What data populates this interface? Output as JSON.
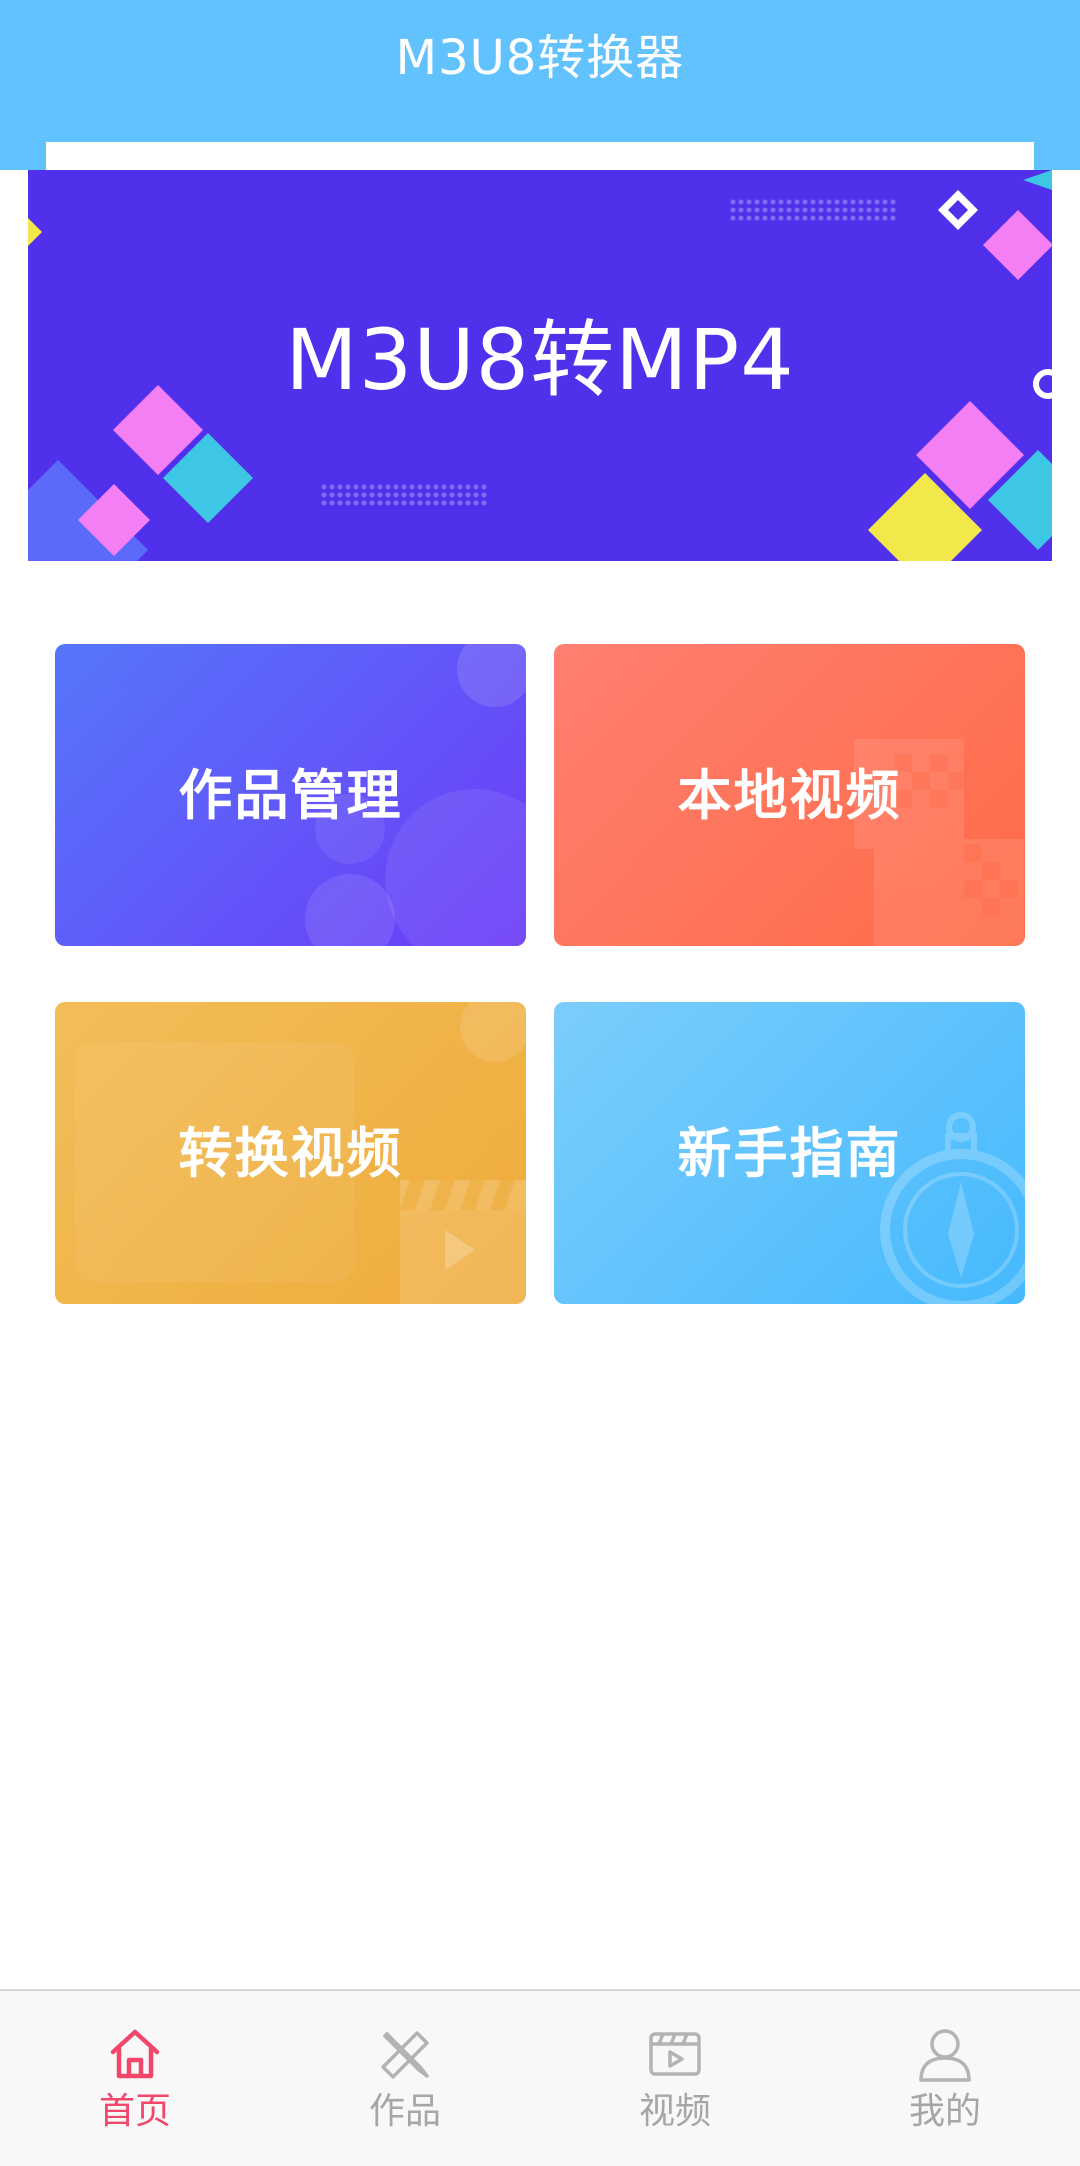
{
  "header": {
    "title": "M3U8转换器",
    "color": "#62c2fd"
  },
  "banner": {
    "text": "M3U8转MP4",
    "background": "#5130ec"
  },
  "cards": [
    {
      "id": "works",
      "label": "作品管理",
      "icon": "bubbles-decoration"
    },
    {
      "id": "local",
      "label": "本地视频",
      "icon": "checker-decoration"
    },
    {
      "id": "convert",
      "label": "转换视频",
      "icon": "clapperboard-icon"
    },
    {
      "id": "guide",
      "label": "新手指南",
      "icon": "compass-icon"
    }
  ],
  "bottom_nav": {
    "items": [
      {
        "label": "首页",
        "icon": "home-icon",
        "active": true
      },
      {
        "label": "作品",
        "icon": "pencil-ruler-icon",
        "active": false
      },
      {
        "label": "视频",
        "icon": "video-icon",
        "active": false
      },
      {
        "label": "我的",
        "icon": "user-icon",
        "active": false
      }
    ],
    "active_color": "#f0476a",
    "inactive_color": "#a6a6a6"
  }
}
